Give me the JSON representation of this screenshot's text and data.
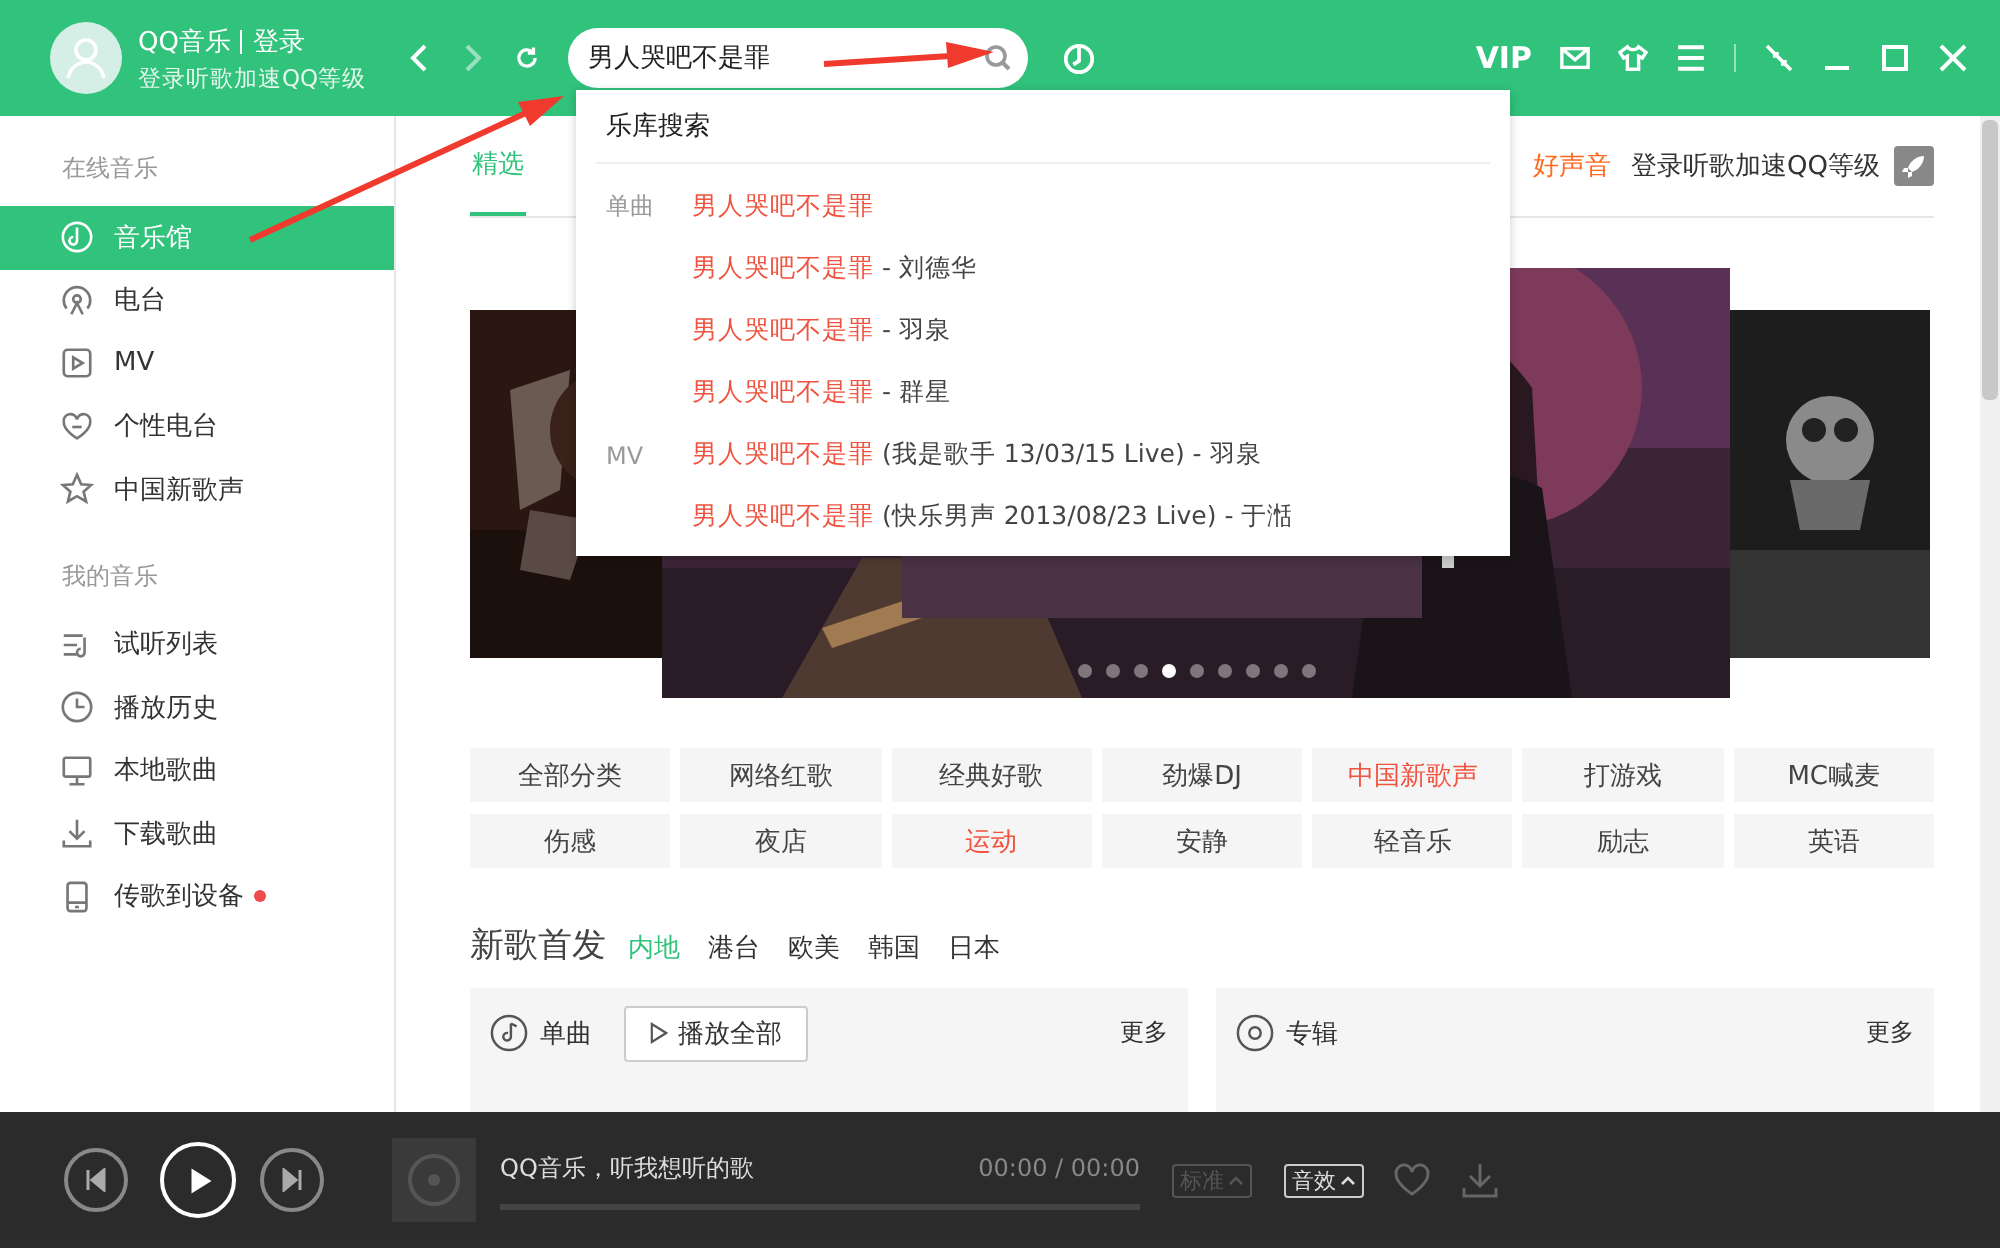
{
  "header": {
    "app_name": "QQ音乐",
    "login": "登录",
    "subtitle": "登录听歌加速QQ等级",
    "search": {
      "value": "男人哭吧不是罪"
    },
    "vip": "VIP"
  },
  "sidebar": {
    "sections": [
      {
        "title": "在线音乐",
        "items": [
          {
            "label": "音乐馆",
            "selected": true,
            "unread": false
          },
          {
            "label": "电台",
            "selected": false,
            "unread": false
          },
          {
            "label": "MV",
            "selected": false,
            "unread": false
          },
          {
            "label": "个性电台",
            "selected": false,
            "unread": false
          },
          {
            "label": "中国新歌声",
            "selected": false,
            "unread": false
          }
        ]
      },
      {
        "title": "我的音乐",
        "items": [
          {
            "label": "试听列表",
            "selected": false,
            "unread": false
          },
          {
            "label": "播放历史",
            "selected": false,
            "unread": false
          },
          {
            "label": "本地歌曲",
            "selected": false,
            "unread": false
          },
          {
            "label": "下载歌曲",
            "selected": false,
            "unread": false
          },
          {
            "label": "传歌到设备",
            "selected": false,
            "unread": true
          }
        ]
      }
    ]
  },
  "tabs": [
    {
      "label": "精选",
      "selected": true
    }
  ],
  "promo": "好声音",
  "login_hint": "登录听歌加速QQ等级",
  "banner": {
    "dots": [
      {
        "selected": false
      },
      {
        "selected": false
      },
      {
        "selected": false
      },
      {
        "selected": true
      },
      {
        "selected": false
      },
      {
        "selected": false
      },
      {
        "selected": false
      },
      {
        "selected": false
      },
      {
        "selected": false
      }
    ]
  },
  "categories": [
    {
      "label": "全部分类",
      "highlighted": false
    },
    {
      "label": "网络红歌",
      "highlighted": false
    },
    {
      "label": "经典好歌",
      "highlighted": false
    },
    {
      "label": "劲爆DJ",
      "highlighted": false
    },
    {
      "label": "中国新歌声",
      "highlighted": true
    },
    {
      "label": "打游戏",
      "highlighted": false
    },
    {
      "label": "MC喊麦",
      "highlighted": false
    },
    {
      "label": "伤感",
      "highlighted": false
    },
    {
      "label": "夜店",
      "highlighted": false
    },
    {
      "label": "运动",
      "highlighted": true
    },
    {
      "label": "安静",
      "highlighted": false
    },
    {
      "label": "轻音乐",
      "highlighted": false
    },
    {
      "label": "励志",
      "highlighted": false
    },
    {
      "label": "英语",
      "highlighted": false
    }
  ],
  "new_songs": {
    "title": "新歌首发",
    "regions": [
      {
        "label": "内地",
        "selected": true
      },
      {
        "label": "港台",
        "selected": false
      },
      {
        "label": "欧美",
        "selected": false
      },
      {
        "label": "韩国",
        "selected": false
      },
      {
        "label": "日本",
        "selected": false
      }
    ],
    "panels": [
      {
        "title": "单曲",
        "play_all": "播放全部",
        "more": "更多"
      },
      {
        "title": "专辑",
        "more": "更多"
      }
    ]
  },
  "dropdown": {
    "title": "乐库搜索",
    "groups": [
      {
        "label": "单曲",
        "results": [
          {
            "match": "男人哭吧不是罪"
          },
          {
            "match": "男人哭吧不是罪",
            "rest": " - 刘德华"
          },
          {
            "match": "男人哭吧不是罪",
            "rest": " - 羽泉"
          },
          {
            "match": "男人哭吧不是罪",
            "rest": " - 群星"
          }
        ]
      },
      {
        "label": "MV",
        "results": [
          {
            "match": "男人哭吧不是罪",
            "rest": " (我是歌手 13/03/15 Live) - 羽泉"
          },
          {
            "match": "男人哭吧不是罪",
            "rest": " (快乐男声 2013/08/23 Live) - 于湉"
          }
        ]
      }
    ]
  },
  "player": {
    "title": "QQ音乐，听我想听的歌",
    "time": "00:00 / 00:00",
    "quality": {
      "label": "标准",
      "disabled": true
    },
    "effects": {
      "label": "音效",
      "disabled": false
    }
  }
}
